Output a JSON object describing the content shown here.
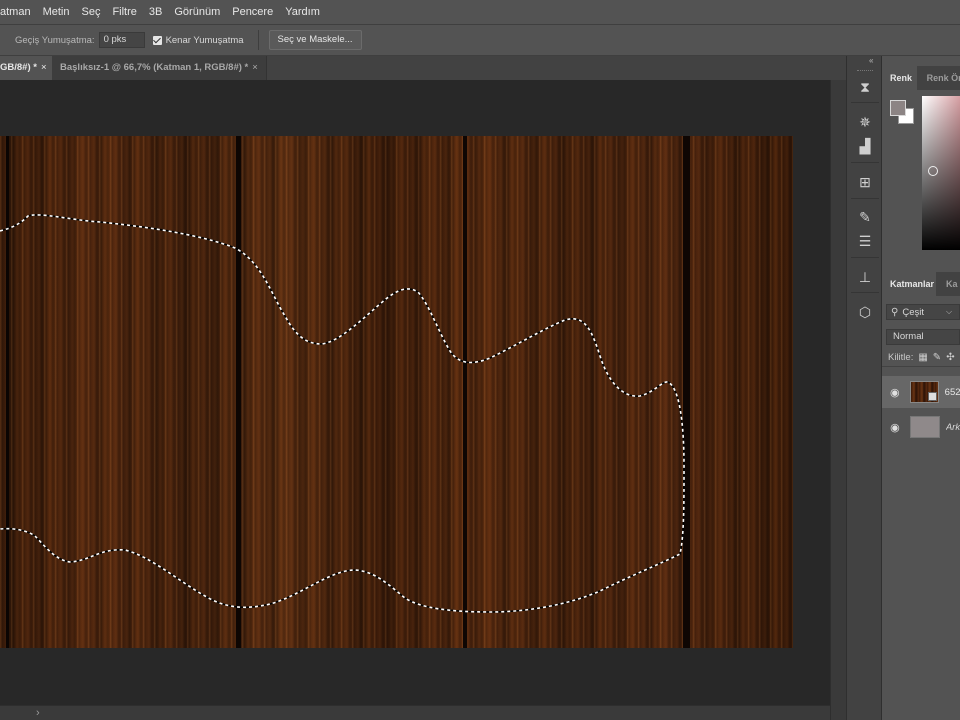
{
  "menu": {
    "items": [
      "atman",
      "Metin",
      "Seç",
      "Filtre",
      "3B",
      "Görünüm",
      "Pencere",
      "Yardım"
    ]
  },
  "options": {
    "feather_label": "Geçiş Yumuşatma:",
    "feather_value": "0 pks",
    "antialias_label": "Kenar Yumuşatma",
    "antialias_checked": true,
    "select_mask_label": "Seç ve Maskele..."
  },
  "doc_tabs": {
    "active_label": "GB/8#) *",
    "inactive_label": "Başlıksız-1 @ 66,7% (Katman 1, RGB/8#) *",
    "close_glyph": "×"
  },
  "color_panel": {
    "tab_active": "Renk",
    "tab_inactive": "Renk Ör",
    "foreground_color": "#8c8484",
    "background_color": "#ffffff"
  },
  "layers_panel": {
    "tab_active": "Katmanlar",
    "tab_inactive": "Ka",
    "filter_label": "Çeşit",
    "blend_mode": "Normal",
    "lock_label": "Kilitle:",
    "layers": [
      {
        "name": "652",
        "visible": true,
        "selected": true
      },
      {
        "name": "Ark",
        "visible": true,
        "selected": false
      }
    ]
  },
  "scrollbar": {
    "arrow": "›"
  }
}
